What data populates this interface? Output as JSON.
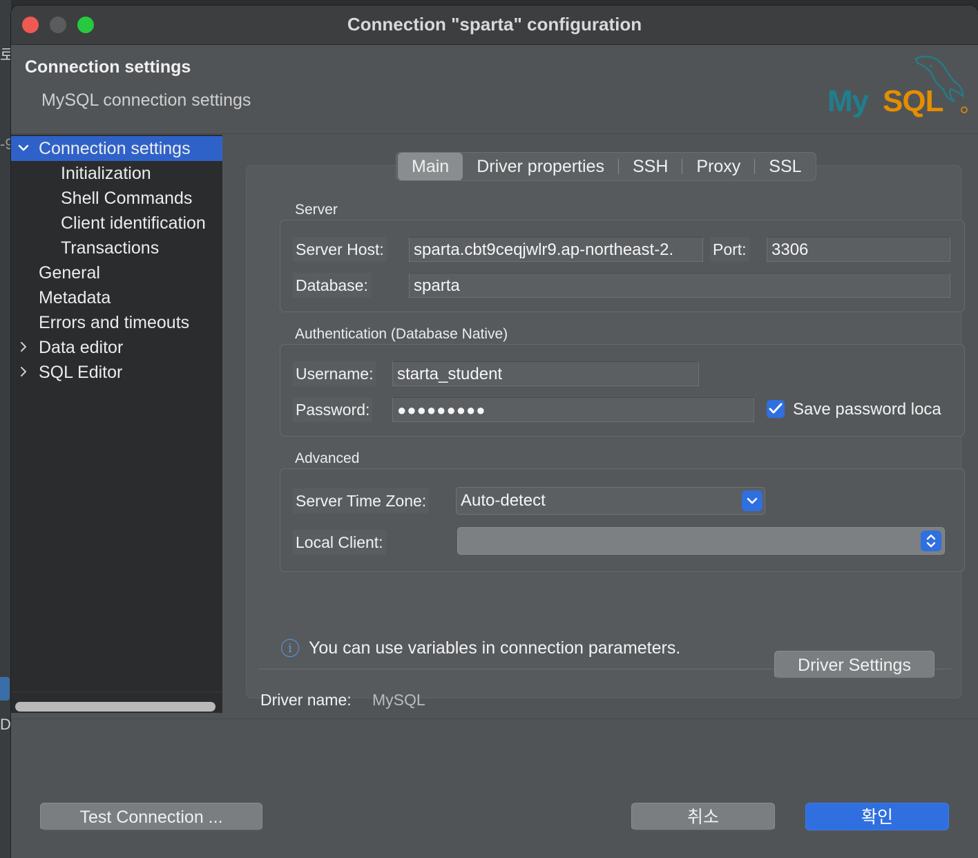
{
  "background": {
    "glyph_top": "로",
    "glyph_mid": "-9",
    "glyph_bottom": "D"
  },
  "window": {
    "title": "Connection \"sparta\" configuration",
    "traffic_lights": {
      "close": "#ee5a52",
      "minimize": "#5a5c5e",
      "maximize": "#27c93f"
    }
  },
  "header": {
    "title": "Connection settings",
    "subtitle": "MySQL connection settings",
    "logo_text": "MySQL"
  },
  "nav": {
    "items": [
      {
        "label": "Connection settings",
        "chevron": "chevron-down-icon",
        "selected": true
      },
      {
        "label": "Initialization"
      },
      {
        "label": "Shell Commands"
      },
      {
        "label": "Client identification"
      },
      {
        "label": "Transactions"
      },
      {
        "label": "General"
      },
      {
        "label": "Metadata"
      },
      {
        "label": "Errors and timeouts"
      },
      {
        "label": "Data editor",
        "chevron": "chevron-right-icon"
      },
      {
        "label": "SQL Editor",
        "chevron": "chevron-right-icon"
      }
    ]
  },
  "tabs": [
    {
      "label": "Main",
      "active": true
    },
    {
      "label": "Driver properties"
    },
    {
      "label": "SSH"
    },
    {
      "label": "Proxy"
    },
    {
      "label": "SSL"
    }
  ],
  "server": {
    "group_label": "Server",
    "host_label": "Server Host:",
    "host_value": "sparta.cbt9ceqjwlr9.ap-northeast-2.",
    "port_label": "Port:",
    "port_value": "3306",
    "database_label": "Database:",
    "database_value": "sparta"
  },
  "auth": {
    "group_label": "Authentication (Database Native)",
    "username_label": "Username:",
    "username_value": "starta_student",
    "password_label": "Password:",
    "password_value": "●●●●●●●●●",
    "save_password_label": "Save password loca",
    "save_password_checked": true
  },
  "advanced": {
    "group_label": "Advanced",
    "timezone_label": "Server Time Zone:",
    "timezone_value": "Auto-detect",
    "local_client_label": "Local Client:",
    "local_client_value": ""
  },
  "info": {
    "icon": "info-icon",
    "text": "You can use variables in connection parameters."
  },
  "driver": {
    "name_label": "Driver name:",
    "name_value": "MySQL",
    "settings_button": "Driver Settings"
  },
  "footer": {
    "test_button": "Test Connection ...",
    "cancel_button": "취소",
    "ok_button": "확인"
  },
  "colors": {
    "accent": "#2f6fe0",
    "selection": "#2f62c9",
    "logo_teal": "#1f7f8c",
    "logo_orange": "#e48e00"
  }
}
